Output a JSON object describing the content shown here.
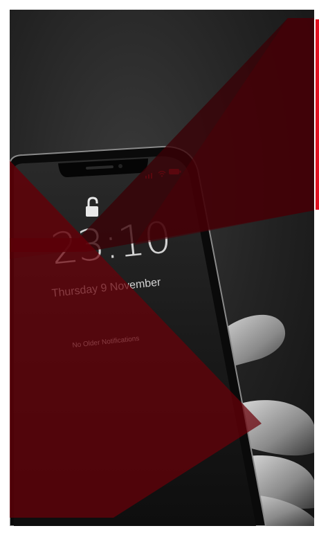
{
  "lock_screen": {
    "time": "23:10",
    "date": "Thursday 9 November",
    "notice": "No Older Notifications"
  },
  "colors": {
    "accent": "#e01020",
    "overlay": "#5a0008"
  },
  "icons": [
    "unlock-icon",
    "wifi-icon",
    "signal-icon",
    "battery-icon"
  ]
}
